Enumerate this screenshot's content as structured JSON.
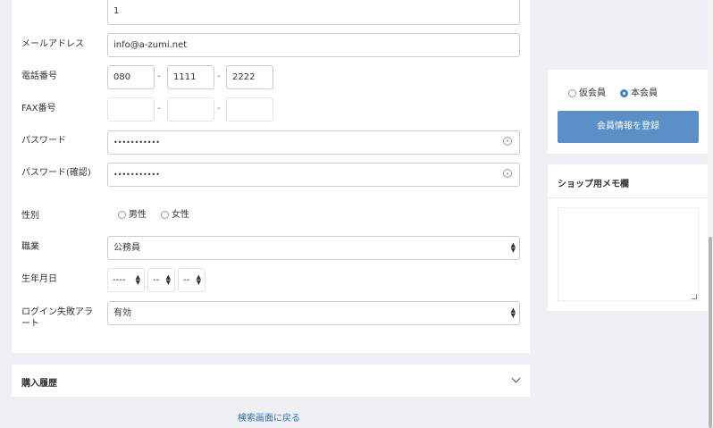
{
  "form": {
    "top_value": "1",
    "email": {
      "label": "メールアドレス",
      "value": "info@a-zumi.net"
    },
    "phone": {
      "label": "電話番号",
      "part1": "080",
      "part2": "1111",
      "part3": "2222",
      "sep": "-"
    },
    "fax": {
      "label": "FAX番号",
      "sep": "-"
    },
    "password": {
      "label": "パスワード",
      "value": "•••••••••••"
    },
    "password_confirm": {
      "label": "パスワード(確認)",
      "value": "•••••••••••"
    },
    "gender": {
      "label": "性別",
      "options": [
        "男性",
        "女性"
      ]
    },
    "job": {
      "label": "職業",
      "value": "公務員"
    },
    "birthday": {
      "label": "生年月日",
      "year": "----",
      "month": "--",
      "day": "--"
    },
    "login_alert": {
      "label": "ログイン失敗アラート",
      "value": "有効"
    }
  },
  "purchase_history": {
    "title": "購入履歴"
  },
  "back_link": "検索画面に戻る",
  "side": {
    "member_options": [
      "仮会員",
      "本会員"
    ],
    "selected": "本会員",
    "register_button": "会員情報を登録",
    "memo_title": "ショップ用メモ欄"
  },
  "colors": {
    "accent": "#5b8fc8",
    "radio_on": "#3c84d0",
    "link": "#2a6fb0"
  }
}
